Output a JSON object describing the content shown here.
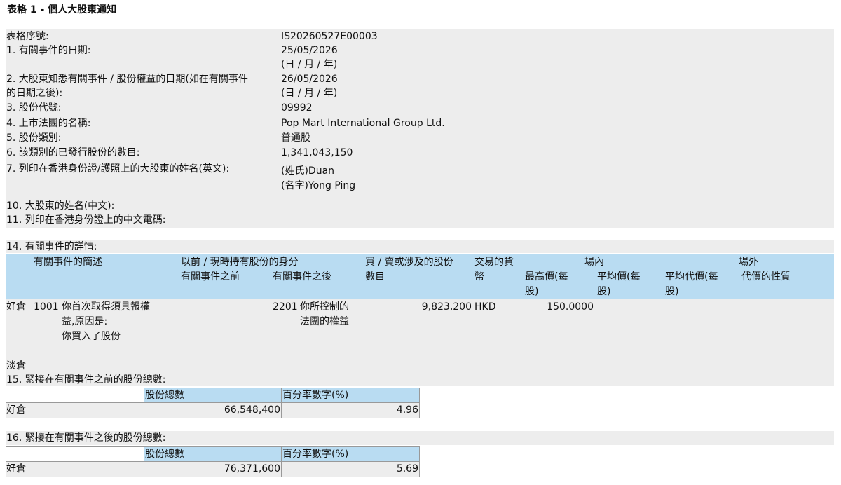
{
  "title": "表格 1 - 個人大股東通知",
  "fields": {
    "serial_label": "表格序號:",
    "serial_value": "IS20260527E00003",
    "event_date_label": "1. 有關事件的日期:",
    "event_date_value": "25/05/2026",
    "event_date_fmt": "(日 / 月 / 年)",
    "aware_date_label_1": "2. 大股東知悉有關事件 / 股份權益的日期(如在有關事件",
    "aware_date_label_2": "的日期之後):",
    "aware_date_value": "26/05/2026",
    "aware_date_fmt": "(日 / 月 / 年)",
    "stock_code_label": "3. 股份代號:",
    "stock_code_value": "09992",
    "corp_name_label": "4. 上市法團的名稱:",
    "corp_name_value": "Pop Mart International Group Ltd.",
    "share_class_label": "5. 股份類別:",
    "share_class_value": "普通股",
    "issued_label": "6. 該類別的已發行股份的數目:",
    "issued_value": "1,341,043,150",
    "name_en_label": "7. 列印在香港身份證/護照上的大股東的姓名(英文):",
    "surname_value": "(姓氏)Duan",
    "given_value": "(名字)Yong Ping",
    "name_cn_label": "10. 大股東的姓名(中文):",
    "cn_code_label": "11. 列印在香港身份證上的中文電碼:",
    "details_label": "14. 有關事件的詳情:"
  },
  "details_table": {
    "headers": {
      "desc": "有關事件的簡述",
      "capacity": "以前 / 現時持有股份的身分",
      "before": "有關事件之前",
      "after": "有關事件之後",
      "shares_1": "買 / 賣或涉及的股份",
      "shares_2": "數目",
      "currency_1": "交易的貨",
      "currency_2": "幣",
      "onex": "場內",
      "high_1": "最高價(每",
      "high_2": "股)",
      "avg_1": "平均價(每",
      "avg_2": "股)",
      "offex": "場外",
      "avgc_1": "平均代價(每",
      "avgc_2": "股)",
      "nature": "代價的性質"
    },
    "row": {
      "position": "好倉",
      "code": "1001",
      "desc_1": "你首次取得須具報權",
      "desc_2": "益,原因是:",
      "desc_3": "你買入了股份",
      "after_code": "2201",
      "after_1": "你所控制的",
      "after_2": "法團的權益",
      "shares": "9,823,200",
      "currency": "HKD",
      "high": "150.0000"
    },
    "short_label": "淡倉"
  },
  "before_total": {
    "label": "15. 緊接在有關事件之前的股份總數:",
    "col_shares": "股份總數",
    "col_pct": "百分率數字(%)",
    "row_label": "好倉",
    "shares": "66,548,400",
    "pct": "4.96"
  },
  "after_total": {
    "label": "16. 緊接在有關事件之後的股份總數:",
    "col_shares": "股份總數",
    "col_pct": "百分率數字(%)",
    "row_label": "好倉",
    "shares": "76,371,600",
    "pct": "5.69"
  },
  "colors": {
    "band_gray": "#ededed",
    "header_blue": "#b9dcf2",
    "border": "#999999"
  }
}
